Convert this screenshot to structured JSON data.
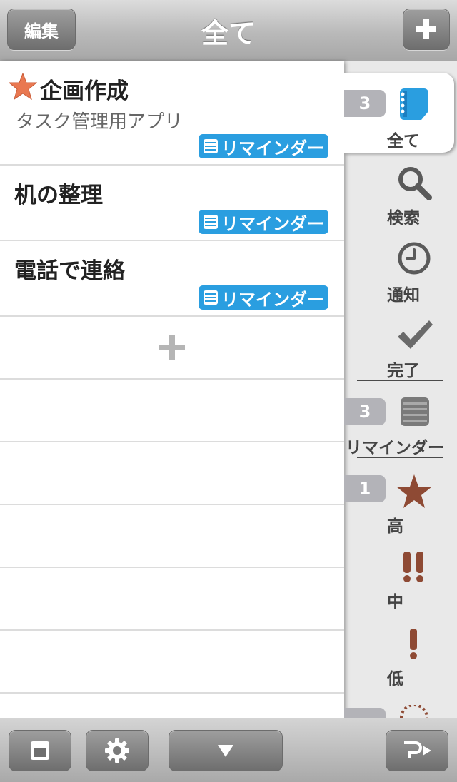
{
  "navbar": {
    "edit_label": "編集",
    "title": "全て",
    "add_icon": "plus-icon"
  },
  "tasks": [
    {
      "title": "企画作成",
      "starred": true,
      "note": "タスク管理用アプリ",
      "tag": "リマインダー"
    },
    {
      "title": "机の整理",
      "starred": false,
      "note": "",
      "tag": "リマインダー"
    },
    {
      "title": "電話で連絡",
      "starred": false,
      "note": "",
      "tag": "リマインダー"
    }
  ],
  "sidebar": {
    "all": {
      "label": "全て",
      "count": "3"
    },
    "search": {
      "label": "検索"
    },
    "notify": {
      "label": "通知"
    },
    "done": {
      "label": "完了"
    },
    "reminder": {
      "label": "リマインダー",
      "count": "3"
    },
    "high": {
      "label": "高",
      "count": "1"
    },
    "medium": {
      "label": "中"
    },
    "low": {
      "label": "低"
    }
  },
  "toolbar": {
    "buttons": [
      "calendar-icon",
      "gear-icon",
      "down-triangle-icon",
      "share-forward-icon"
    ]
  },
  "colors": {
    "accent": "#2a9ee0",
    "star": "#e97851",
    "priority": "#8e4a34"
  }
}
